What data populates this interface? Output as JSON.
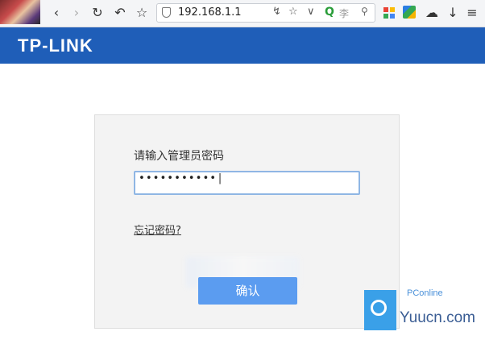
{
  "browser": {
    "address": "192.168.1.1",
    "search_text": "李",
    "icons": [
      "back-icon",
      "forward-icon",
      "reload-icon",
      "undo-icon",
      "star-icon",
      "shield-icon",
      "lightning-icon",
      "star-icon",
      "chevron-down-icon",
      "search-q-icon",
      "search-icon",
      "apps-icon",
      "color-app-icon",
      "cloud-icon",
      "download-icon",
      "menu-icon"
    ]
  },
  "header": {
    "logo": "TP-LINK",
    "bg": "#1f5eb8"
  },
  "login": {
    "prompt": "请输入管理员密码",
    "password_value": "•••••••••••",
    "forgot_link": "忘记密码?",
    "confirm_button": "确认",
    "button_color": "#5b9cf0"
  },
  "watermark": {
    "brand": "PConline",
    "site": "Yuucn.com"
  }
}
